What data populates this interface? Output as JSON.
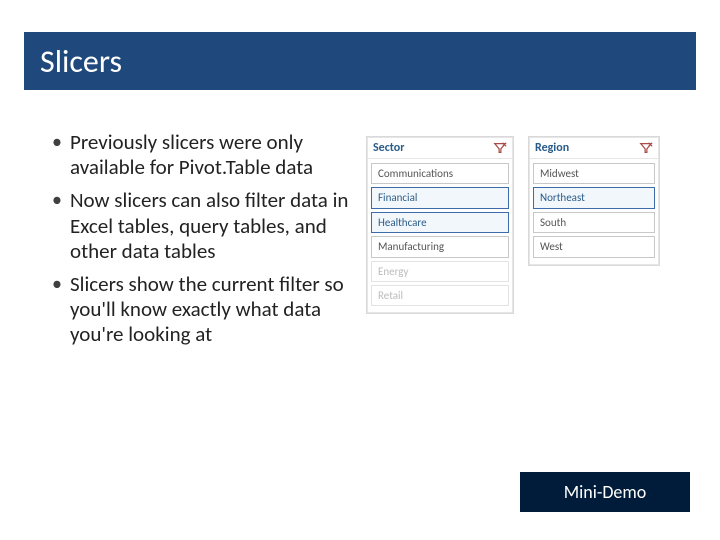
{
  "title": "Slicers",
  "bullets": [
    "Previously slicers were only available for Pivot.Table data",
    "Now slicers can also filter data in Excel tables, query tables, and other data tables",
    "Slicers show the current filter so you'll know exactly what data you're looking at"
  ],
  "slicer_left": {
    "header": "Sector",
    "items": [
      {
        "label": "Communications",
        "state": "normal"
      },
      {
        "label": "Financial",
        "state": "selected"
      },
      {
        "label": "Healthcare",
        "state": "selected"
      },
      {
        "label": "Manufacturing",
        "state": "normal"
      },
      {
        "label": "Energy",
        "state": "dim"
      },
      {
        "label": "Retail",
        "state": "dim"
      }
    ]
  },
  "slicer_right": {
    "header": "Region",
    "items": [
      {
        "label": "Midwest",
        "state": "normal"
      },
      {
        "label": "Northeast",
        "state": "selected"
      },
      {
        "label": "South",
        "state": "normal"
      },
      {
        "label": "West",
        "state": "normal"
      }
    ]
  },
  "button": {
    "label": "Mini-Demo"
  }
}
